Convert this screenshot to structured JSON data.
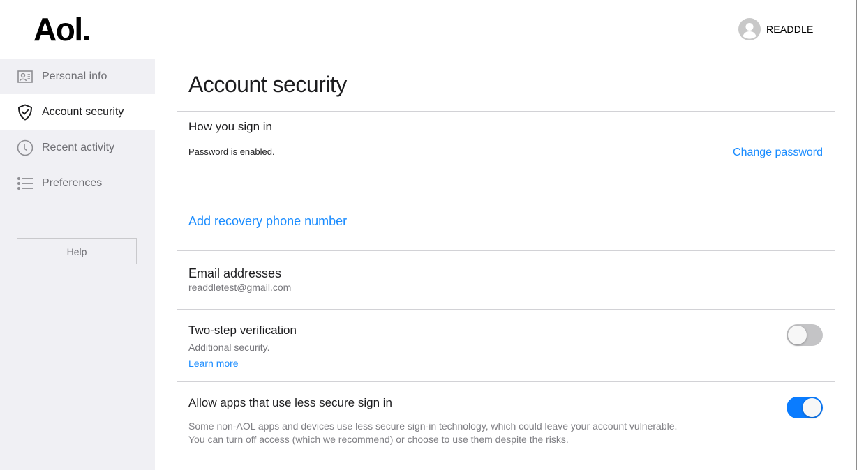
{
  "brand": {
    "logo_text": "Aol."
  },
  "user": {
    "name": "READDLE",
    "avatar_icon": "user-avatar-icon"
  },
  "sidebar": {
    "items": [
      {
        "label": "Personal info",
        "icon": "id-card-icon",
        "active": false
      },
      {
        "label": "Account security",
        "icon": "shield-check-icon",
        "active": true
      },
      {
        "label": "Recent activity",
        "icon": "clock-icon",
        "active": false
      },
      {
        "label": "Preferences",
        "icon": "list-icon",
        "active": false
      }
    ],
    "help_label": "Help"
  },
  "main": {
    "title": "Account security",
    "sign_in": {
      "title": "How you sign in",
      "status": "Password is enabled.",
      "change_password_label": "Change password"
    },
    "recovery": {
      "add_phone_label": "Add recovery phone number"
    },
    "email": {
      "title": "Email addresses",
      "address": "readdletest@gmail.com"
    },
    "two_step": {
      "title": "Two-step verification",
      "subtitle": "Additional security.",
      "learn_more_label": "Learn more",
      "enabled": false
    },
    "less_secure": {
      "title": "Allow apps that use less secure sign in",
      "description_line1": "Some non-AOL apps and devices use less secure sign-in technology, which could leave your account vulnerable.",
      "description_line2": "You can turn off access (which we recommend) or choose to use them despite the risks.",
      "enabled": true
    }
  },
  "colors": {
    "link": "#1a8cff",
    "toggle_on": "#0a7cff",
    "toggle_off": "#c4c4c6",
    "sidebar_bg": "#f0f0f4"
  }
}
